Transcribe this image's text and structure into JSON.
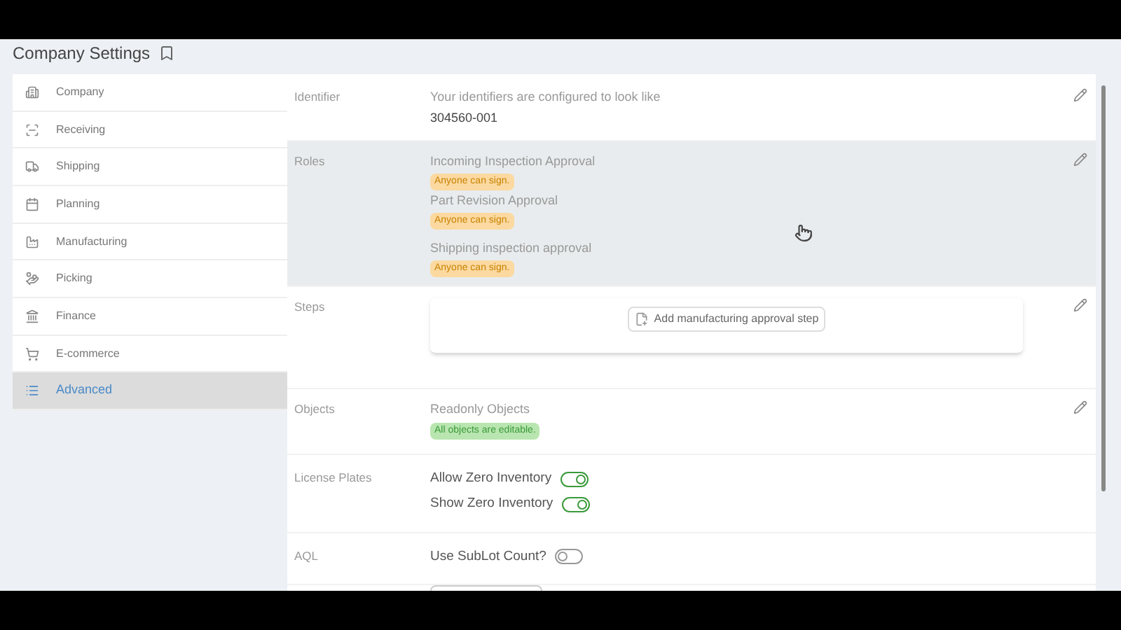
{
  "page": {
    "title": "Company Settings"
  },
  "sidebar": {
    "items": [
      {
        "label": "Company",
        "selected": false
      },
      {
        "label": "Receiving",
        "selected": false
      },
      {
        "label": "Shipping",
        "selected": false
      },
      {
        "label": "Planning",
        "selected": false
      },
      {
        "label": "Manufacturing",
        "selected": false
      },
      {
        "label": "Picking",
        "selected": false
      },
      {
        "label": "Finance",
        "selected": false
      },
      {
        "label": "E-commerce",
        "selected": false
      },
      {
        "label": "Advanced",
        "selected": true
      }
    ]
  },
  "sections": [
    {
      "kind": "identifier",
      "label": "Identifier",
      "highlighted": false,
      "editable": true,
      "description": "Your identifiers are configured to look like",
      "value": "304560-001"
    },
    {
      "kind": "roles",
      "label": "Roles",
      "highlighted": true,
      "editable": true,
      "roles": [
        {
          "name": "Incoming Inspection Approval",
          "badge": "Anyone can sign."
        },
        {
          "name": "Part Revision Approval",
          "badge": "Anyone can sign."
        },
        {
          "name": "Shipping inspection approval",
          "badge": "Anyone can sign."
        }
      ]
    },
    {
      "kind": "steps",
      "label": "Steps",
      "highlighted": false,
      "editable": true,
      "button": "Add manufacturing approval step"
    },
    {
      "kind": "objects",
      "label": "Objects",
      "highlighted": false,
      "editable": true,
      "title": "Readonly Objects",
      "badge": "All objects are editable."
    },
    {
      "kind": "toggles",
      "label": "License Plates",
      "highlighted": false,
      "editable": false,
      "toggles": [
        {
          "label": "Allow Zero Inventory",
          "on": true
        },
        {
          "label": "Show Zero Inventory",
          "on": true
        }
      ]
    },
    {
      "kind": "toggles",
      "label": "AQL",
      "highlighted": false,
      "editable": false,
      "toggles": [
        {
          "label": "Use SubLot Count?",
          "on": false
        }
      ]
    }
  ]
}
